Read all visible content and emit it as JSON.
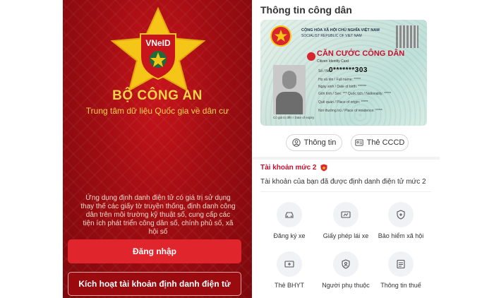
{
  "login_screen": {
    "emblem_text": "VNeID",
    "title": "BỘ CÔNG AN",
    "subtitle": "Trung tâm dữ liệu Quốc gia về dân cư",
    "description": "Ứng dụng định danh điện tử có giá trị sử dụng thay thế các giấy tờ truyền thống, định danh công dân trên môi trường kỹ thuật số, cung cấp các tiện ích phát triển công dân số, chính phủ số, xã hội số",
    "login_button": "Đăng nhập",
    "activate_button": "Kích hoạt tài khoản định danh điện tử",
    "colors": {
      "background": "#a00d12",
      "accent": "#f7d34a",
      "button": "#e0262c"
    }
  },
  "citizen_screen": {
    "header": "Thông tin công dân",
    "card": {
      "country_line": "CỘNG HÒA XÃ HỘI CHỦ NGHĨA VIỆT NAM",
      "country_sub": "SOCIALIST REPUBLIC OF VIET NAM",
      "title": "CĂN CƯỚC CÔNG DÂN",
      "title_en": "Citizen Identity Card",
      "number_label": "Số / No.",
      "number": "0*******303",
      "fields": [
        "Họ và tên / Full name: *****",
        "Ngày sinh / Date of birth: ******",
        "Giới tính / Sex: ***   Quốc tịch / Nationality: *****",
        "Quê quán / Place of origin: *****",
        "Nơi thường trú / Place of residence: *****"
      ],
      "photo_caption": "Có giá trị đến / Date of expiry"
    },
    "tabs": [
      {
        "label": "Thông tin",
        "icon": "user-circle-icon"
      },
      {
        "label": "Thẻ CCCD",
        "icon": "id-card-icon"
      }
    ],
    "account_level": "Tài khoản mức 2",
    "account_desc": "Tài khoản của bạn đã được định danh điện tử mức 2",
    "services": [
      {
        "label": "Đăng ký xe",
        "icon": "car-icon"
      },
      {
        "label": "Giấy phép lái xe",
        "icon": "license-icon"
      },
      {
        "label": "Bảo hiểm xã hội",
        "icon": "shield-plus-icon"
      },
      {
        "label": "Thẻ BHYT",
        "icon": "health-card-icon"
      },
      {
        "label": "Người phụ thuộc",
        "icon": "dependent-icon"
      },
      {
        "label": "Thông tin thuế",
        "icon": "tax-icon"
      }
    ],
    "colors": {
      "accent": "#c8102e"
    }
  }
}
